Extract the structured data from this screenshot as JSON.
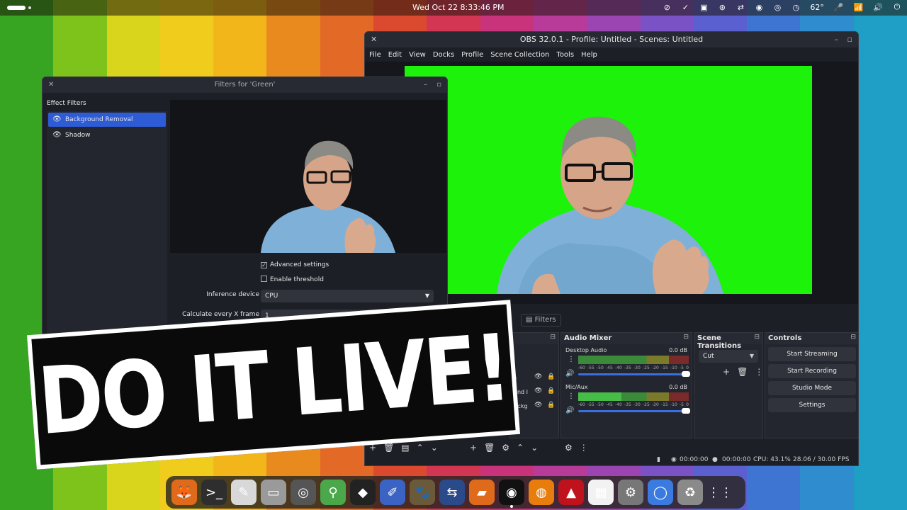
{
  "wallpaper": {
    "stripes": [
      "#37a521",
      "#7dc31b",
      "#d9d51c",
      "#f0cd1c",
      "#f2b51a",
      "#e98a1e",
      "#e26a26",
      "#db4a2e",
      "#d23652",
      "#c9337c",
      "#b83b9a",
      "#9b45b3",
      "#7b52c6",
      "#5a60cf",
      "#3f75d2",
      "#2f8ccf",
      "#1f9fc6"
    ]
  },
  "topbar": {
    "clock": "Wed Oct 22     8:33:46 PM",
    "tray": [
      "⊘",
      "✓",
      "▣",
      "⊛",
      "⇄",
      "◉",
      "◎",
      "◷",
      "62°",
      "🎤",
      "📶",
      "🔊",
      "⏻"
    ]
  },
  "obs": {
    "title": "OBS 32.0.1 - Profile: Untitled - Scenes: Untitled",
    "menu": [
      "File",
      "Edit",
      "View",
      "Docks",
      "Profile",
      "Scene Collection",
      "Tools",
      "Help"
    ],
    "filters_button": "Filters",
    "audio_mixer": {
      "title": "Audio Mixer",
      "tracks": [
        {
          "name": "Desktop Audio",
          "db": "0.0 dB",
          "level": 0.0
        },
        {
          "name": "Mic/Aux",
          "db": "0.0 dB",
          "level": 0.39
        }
      ],
      "ticks": [
        "-60",
        "-55",
        "-50",
        "-45",
        "-40",
        "-35",
        "-30",
        "-25",
        "-20",
        "-15",
        "-10",
        "-5",
        "0"
      ]
    },
    "scene_transitions": {
      "title": "Scene Transitions",
      "selected": "Cut"
    },
    "controls": {
      "title": "Controls",
      "buttons": [
        "Start Streaming",
        "Start Recording",
        "Studio Mode",
        "Settings"
      ]
    },
    "sources_partial": [
      "ce",
      "ound I",
      "Backg"
    ],
    "status": {
      "stream_time": "00:00:00",
      "rec_time": "00:00:00",
      "cpu": "CPU: 43.1%",
      "fps": "28.06 / 30.00 FPS"
    }
  },
  "filters_window": {
    "title": "Filters for 'Green'",
    "effect_label": "Effect Filters",
    "items": [
      "Background Removal",
      "Shadow"
    ],
    "advanced_settings": "Advanced settings",
    "enable_threshold": "Enable threshold",
    "inference_label": "Inference device",
    "inference_value": "CPU",
    "calc_label": "Calculate every X frame",
    "calc_value": "1"
  },
  "banner": {
    "text": "DO IT LIVE!"
  },
  "taskbar": {
    "apps": [
      {
        "name": "firefox",
        "glyph": "🦊",
        "bg": "#e06a1c"
      },
      {
        "name": "terminal",
        "glyph": ">_",
        "bg": "#2e2e2e"
      },
      {
        "name": "text-editor",
        "glyph": "✎",
        "bg": "#d8d8d8"
      },
      {
        "name": "files",
        "glyph": "▭",
        "bg": "#9a9a9a"
      },
      {
        "name": "disk-usage",
        "glyph": "◎",
        "bg": "#555"
      },
      {
        "name": "maps",
        "glyph": "⚲",
        "bg": "#4aa84a"
      },
      {
        "name": "inkscape",
        "glyph": "◆",
        "bg": "#222"
      },
      {
        "name": "krita",
        "glyph": "✐",
        "bg": "#3a63c4"
      },
      {
        "name": "gimp",
        "glyph": "🐾",
        "bg": "#6b5a3a"
      },
      {
        "name": "kdenlive",
        "glyph": "⇆",
        "bg": "#2a4a8a"
      },
      {
        "name": "shotcut",
        "glyph": "▰",
        "bg": "#e06a1c"
      },
      {
        "name": "obs",
        "glyph": "◉",
        "bg": "#111"
      },
      {
        "name": "blender",
        "glyph": "◍",
        "bg": "#e87d0d"
      },
      {
        "name": "acrobat",
        "glyph": "▲",
        "bg": "#c0121c"
      },
      {
        "name": "calendar",
        "glyph": "▦",
        "bg": "#f2f2f2"
      },
      {
        "name": "settings",
        "glyph": "⚙",
        "bg": "#777"
      },
      {
        "name": "chromium",
        "glyph": "◯",
        "bg": "#3b7be0"
      },
      {
        "name": "trash",
        "glyph": "♻",
        "bg": "#8a8a8a"
      },
      {
        "name": "app-grid",
        "glyph": "⋮⋮",
        "bg": "transparent"
      }
    ]
  }
}
